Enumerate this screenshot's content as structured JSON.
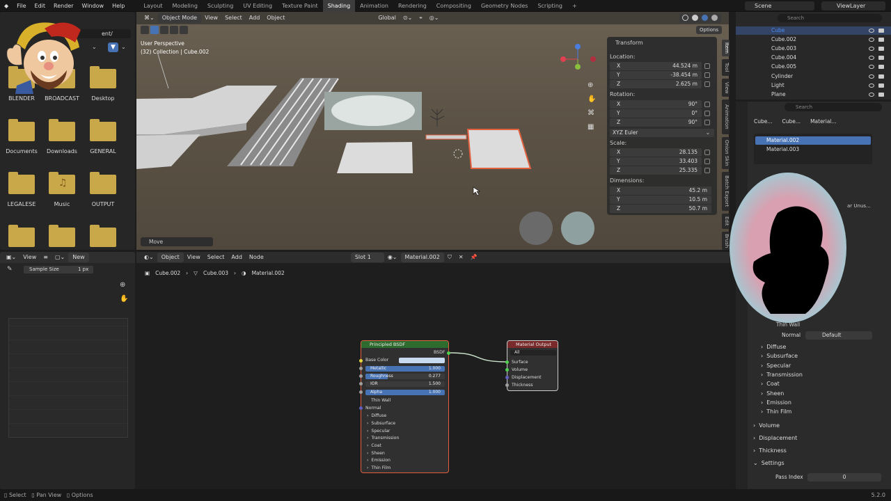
{
  "menu": [
    "File",
    "Edit",
    "Render",
    "Window",
    "Help"
  ],
  "workspaces": [
    "Layout",
    "Modeling",
    "Sculpting",
    "UV Editing",
    "Texture Paint",
    "Shading",
    "Animation",
    "Rendering",
    "Compositing",
    "Geometry Nodes",
    "Scripting"
  ],
  "active_workspace": "Shading",
  "scene": "Scene",
  "view_layer": "ViewLayer",
  "file_browser": {
    "path": "ent/",
    "folders": [
      "BLENDER",
      "BROADCAST",
      "Desktop",
      "Documents",
      "Downloads",
      "GENERAL",
      "LEGALESE",
      "Music",
      "OUTPUT"
    ]
  },
  "image_editor": {
    "view": "View",
    "new": "New",
    "sample_label": "Sample Size",
    "sample_value": "1 px"
  },
  "viewport": {
    "mode": "Object Mode",
    "menus": [
      "View",
      "Select",
      "Add",
      "Object"
    ],
    "transform_orientation": "Global",
    "options": "Options",
    "perspective": "User Perspective",
    "collection": "(32) Collection | Cube.002",
    "operator": "Move"
  },
  "transform": {
    "title": "Transform",
    "location_label": "Location:",
    "location": [
      {
        "k": "X",
        "v": "44.524 m"
      },
      {
        "k": "Y",
        "v": "-38.454 m"
      },
      {
        "k": "Z",
        "v": "2.625 m"
      }
    ],
    "rotation_label": "Rotation:",
    "rotation": [
      {
        "k": "X",
        "v": "90°"
      },
      {
        "k": "Y",
        "v": "0°"
      },
      {
        "k": "Z",
        "v": "90°"
      }
    ],
    "rotation_mode": "XYZ Euler",
    "scale_label": "Scale:",
    "scale": [
      {
        "k": "X",
        "v": "28.135"
      },
      {
        "k": "Y",
        "v": "33.403"
      },
      {
        "k": "Z",
        "v": "25.335"
      }
    ],
    "dimensions_label": "Dimensions:",
    "dimensions": [
      {
        "k": "X",
        "v": "45.2 m"
      },
      {
        "k": "Y",
        "v": "10.5 m"
      },
      {
        "k": "Z",
        "v": "50.7 m"
      }
    ]
  },
  "side_tabs": [
    "Item",
    "Tool",
    "View",
    "Animation",
    "Onion Skin",
    "Batch Export",
    "Edit",
    "Brush"
  ],
  "node_editor": {
    "menus": [
      "View",
      "Select",
      "Add",
      "Node"
    ],
    "object": "Object",
    "slot": "Slot 1",
    "material": "Material.002",
    "breadcrumb": [
      "Cube.002",
      "Cube.003",
      "Material.002"
    ]
  },
  "bsdf_node": {
    "title": "Principled BSDF",
    "output": "BSDF",
    "base_color": "Base Color",
    "metallic": {
      "label": "Metallic",
      "value": "1.000"
    },
    "roughness": {
      "label": "Roughness",
      "value": "0.277"
    },
    "ior": {
      "label": "IOR",
      "value": "1.500"
    },
    "alpha": {
      "label": "Alpha",
      "value": "1.000"
    },
    "thin_wall": "Thin Wall",
    "normal": "Normal",
    "panels": [
      "Diffuse",
      "Subsurface",
      "Specular",
      "Transmission",
      "Coat",
      "Sheen",
      "Emission",
      "Thin Film"
    ]
  },
  "output_node": {
    "title": "Material Output",
    "target": "All",
    "inputs": [
      "Surface",
      "Volume",
      "Displacement",
      "Thickness"
    ]
  },
  "outliner": {
    "search": "Search",
    "items": [
      "Cube",
      "Cube.002",
      "Cube.003",
      "Cube.004",
      "Cube.005",
      "Cylinder",
      "Light",
      "Plane"
    ]
  },
  "properties": {
    "search": "Search",
    "breadcrumb": [
      "Cube...",
      "Cube...",
      "Material..."
    ],
    "materials": [
      "Material.002",
      "Material.003"
    ],
    "thin_wall": "Thin Wall",
    "normal_label": "Normal",
    "normal_value": "Default",
    "subpanels": [
      "Diffuse",
      "Subsurface",
      "Specular",
      "Transmission",
      "Coat",
      "Sheen",
      "Emission",
      "Thin Film"
    ],
    "sections": [
      "Volume",
      "Displacement",
      "Thickness",
      "Settings"
    ],
    "pass_index_label": "Pass Index",
    "pass_index_value": "0",
    "unused": "ar Unus..."
  },
  "status": {
    "select": "Select",
    "pan": "Pan View",
    "options": "Options",
    "version": "5.2.0"
  },
  "colors": {
    "accent": "#4772b3",
    "active_outline": "#e06040",
    "folder": "#c9a84a",
    "bsdf_header": "#2e6b2e",
    "output_header": "#7a2a2a"
  }
}
